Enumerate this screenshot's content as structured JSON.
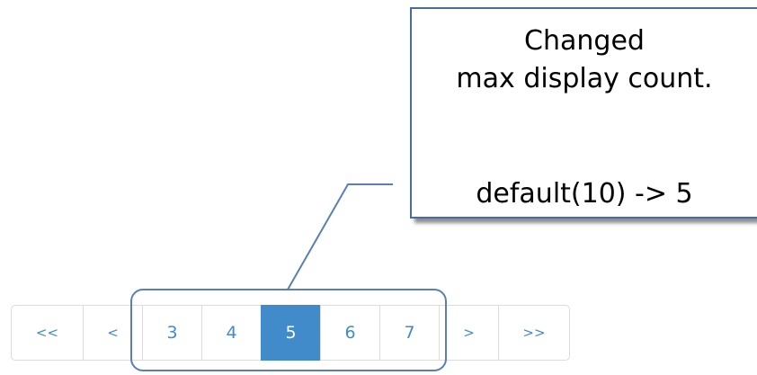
{
  "callout": {
    "line1": "Changed",
    "line2": "max display count.",
    "line3": "default(10) -> 5"
  },
  "pagination": {
    "first": "<<",
    "prev": "<",
    "pages": [
      "3",
      "4",
      "5",
      "6",
      "7"
    ],
    "active_page": "5",
    "next": ">",
    "last": ">>"
  },
  "colors": {
    "accent": "#428bca",
    "callout_border": "#4a6aa3",
    "highlight_border": "#5a7eb5"
  }
}
